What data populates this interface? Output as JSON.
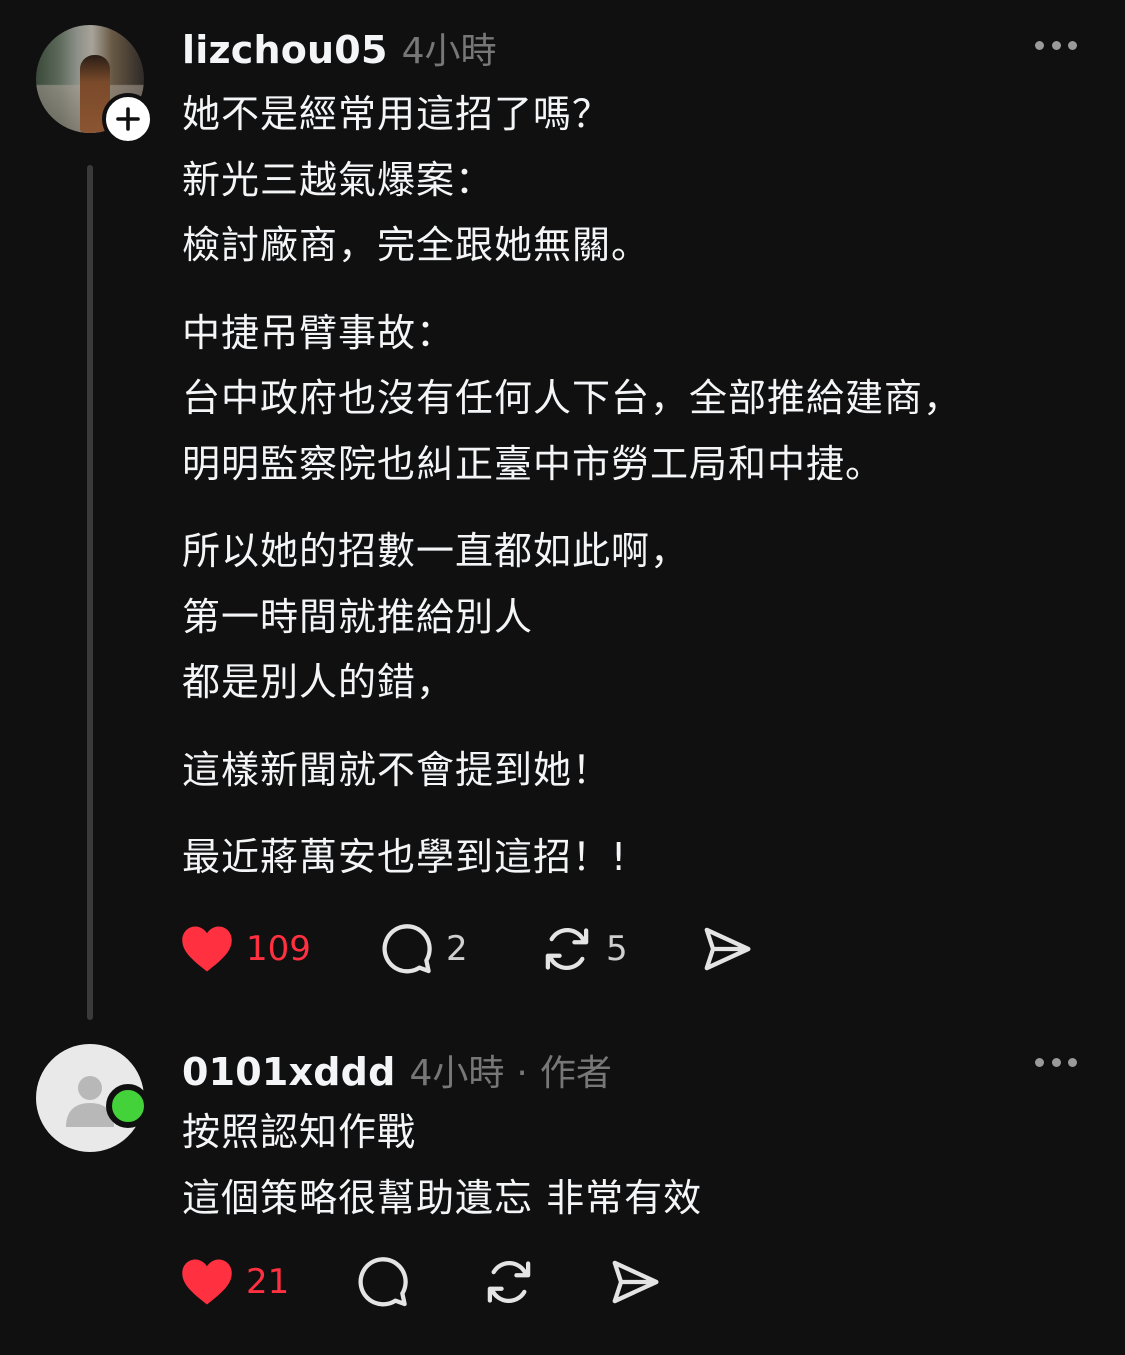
{
  "posts": [
    {
      "username": "lizchou05",
      "time": "4小時",
      "paragraphs": [
        [
          "她不是經常用這招了嗎？",
          "新光三越氣爆案：",
          "檢討廠商，完全跟她無關。"
        ],
        [
          "中捷吊臂事故：",
          "台中政府也沒有任何人下台，全部推給建商，",
          "明明監察院也糾正臺中市勞工局和中捷。"
        ],
        [
          "所以她的招數一直都如此啊，",
          "第一時間就推給別人",
          "都是別人的錯，"
        ],
        [
          "這樣新聞就不會提到她！"
        ],
        [
          "最近蔣萬安也學到這招！!"
        ]
      ],
      "likes": "109",
      "replies": "2",
      "reposts": "5"
    },
    {
      "username": "0101xddd",
      "time": "4小時",
      "separator": "·",
      "role": "作者",
      "paragraphs": [
        [
          "按照認知作戰",
          "這個策略很幫助遺忘 非常有效"
        ]
      ],
      "likes": "21"
    }
  ],
  "icons": {
    "like": "heart-filled-icon",
    "reply": "comment-bubble-icon",
    "repost": "repost-arrows-icon",
    "share": "send-paper-plane-icon",
    "more": "more-dots-icon",
    "follow": "plus-icon",
    "default_avatar": "person-icon"
  },
  "colors": {
    "background": "#101010",
    "text": "#f3f5f7",
    "muted": "#777777",
    "like": "#ff3040",
    "online": "#44d23a"
  }
}
